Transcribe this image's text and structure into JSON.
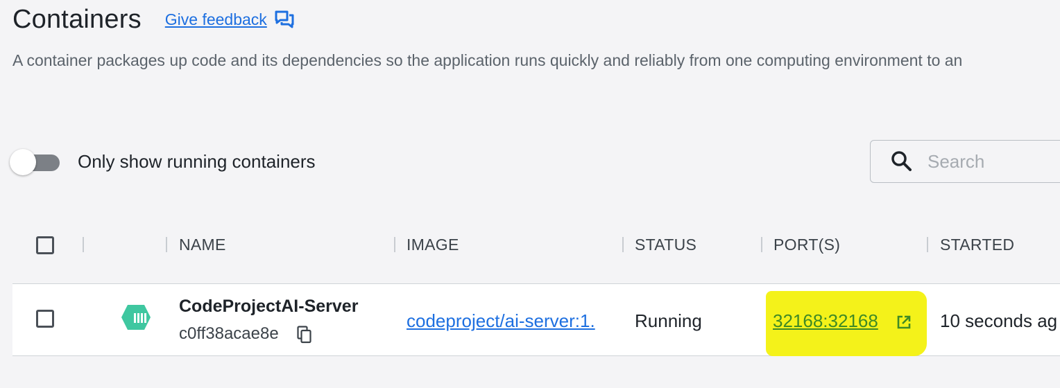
{
  "header": {
    "title": "Containers",
    "feedback_label": "Give feedback",
    "feedback_icon": "feedback-chat-icon"
  },
  "description": "A container packages up code and its dependencies so the application runs quickly and reliably from one computing environment to an",
  "filter": {
    "toggle_label": "Only show running containers",
    "toggle_on": false
  },
  "search": {
    "placeholder": "Search",
    "value": ""
  },
  "table": {
    "columns": {
      "name": "NAME",
      "image": "IMAGE",
      "status": "STATUS",
      "ports": "PORT(S)",
      "started": "STARTED"
    },
    "rows": [
      {
        "name": "CodeProjectAI-Server",
        "id": "c0ff38acae8e",
        "image": "codeproject/ai-server:1.",
        "status": "Running",
        "ports": "32168:32168",
        "started": "10 seconds ag"
      }
    ]
  },
  "colors": {
    "link_blue": "#1d6fe0",
    "port_green": "#3f8a25",
    "highlight_yellow": "#f4f21a",
    "container_icon_teal": "#3fc7a0"
  }
}
